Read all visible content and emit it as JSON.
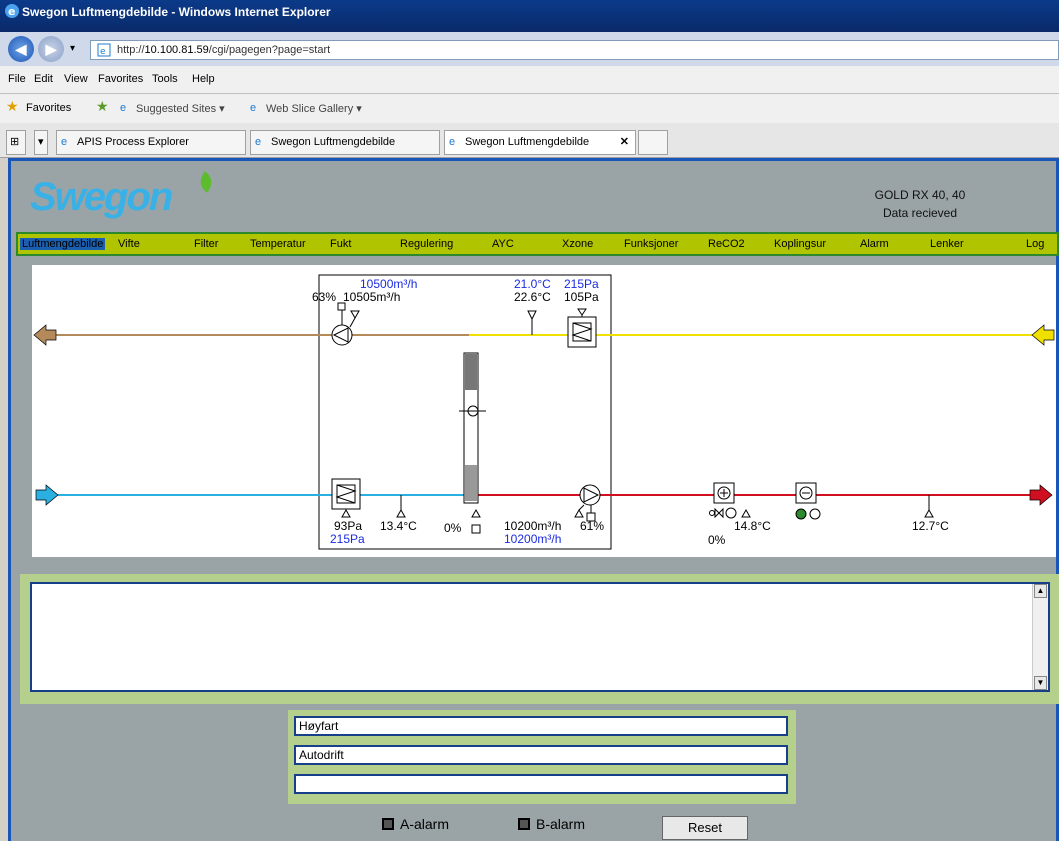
{
  "window": {
    "title": "Swegon Luftmengdebilde - Windows Internet Explorer"
  },
  "address": {
    "url_prefix": "http://",
    "url_host": "10.100.81.59",
    "url_path": "/cgi/pagegen?page=start"
  },
  "menu": [
    "File",
    "Edit",
    "View",
    "Favorites",
    "Tools",
    "Help"
  ],
  "favorites": {
    "label": "Favorites",
    "suggested": "Suggested Sites ▾",
    "webslice": "Web Slice Gallery ▾"
  },
  "tabs": [
    {
      "label": "APIS Process Explorer"
    },
    {
      "label": "Swegon Luftmengdebilde"
    },
    {
      "label": "Swegon Luftmengdebilde",
      "active": true,
      "close": "✕"
    }
  ],
  "header": {
    "logo": "Swegon",
    "unit": "GOLD RX 40, 40",
    "status": "Data recieved"
  },
  "nav": [
    "Luftmengdebilde",
    "Vifte",
    "Filter",
    "Temperatur",
    "Fukt",
    "Regulering",
    "AYC",
    "Xzone",
    "Funksjoner",
    "ReCO2",
    "Koplingsur",
    "Alarm",
    "Lenker",
    "Log"
  ],
  "diagram": {
    "exhaust_fan": {
      "flow_set": "10500m³/h",
      "speed": "63%",
      "flow": "10505m³/h"
    },
    "extract_sensor": {
      "temp_set": "21.0°C",
      "pressure_set": "215Pa",
      "temp": "22.6°C",
      "pressure": "105Pa"
    },
    "supply_filter": {
      "pressure": "93Pa",
      "pressure_set": "215Pa"
    },
    "outdoor_temp": "13.4°C",
    "rotor": "0%",
    "supply_fan": {
      "flow": "10200m³/h",
      "speed": "61%",
      "flow_set": "10200m³/h"
    },
    "heater": {
      "temp": "14.8°C",
      "valve": "0%"
    },
    "supply_temp": "12.7°C"
  },
  "modes": {
    "line1": "Høyfart",
    "line2": "Autodrift",
    "line3": ""
  },
  "alarms": {
    "a": "A-alarm",
    "b": "B-alarm"
  },
  "buttons": {
    "reset": "Reset"
  },
  "colors": {
    "exhaust": "#b48a5a",
    "extract": "#f0e000",
    "supply_cold": "#2ab0e0",
    "supply_warm": "#d01020"
  }
}
